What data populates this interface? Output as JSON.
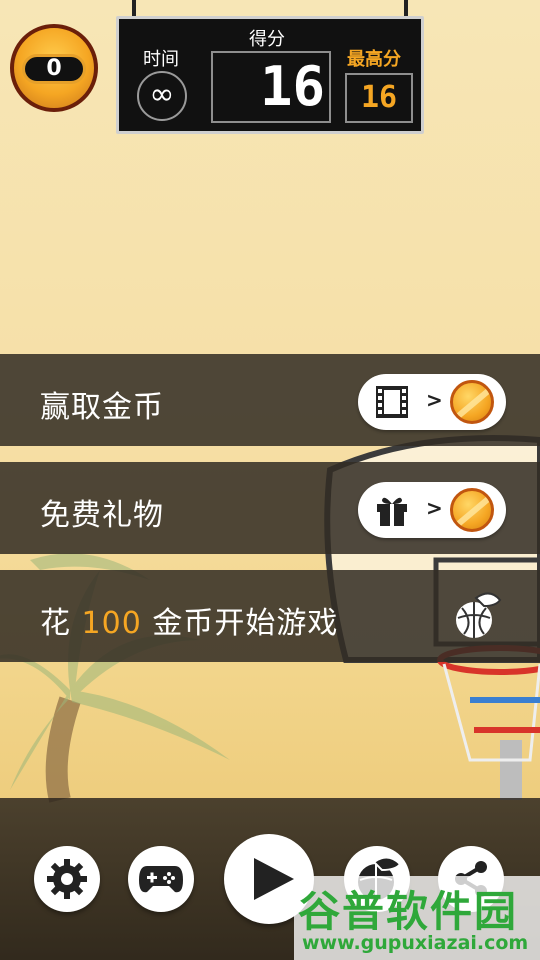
{
  "coins": "0",
  "scoreboard": {
    "time_label": "时间",
    "time_value": "∞",
    "score_label": "得分",
    "score": "16",
    "best_label": "最高分",
    "best": "16"
  },
  "menu": {
    "earn_coins": {
      "label": "赢取金币",
      "arrow": ">",
      "icon": "film-icon"
    },
    "free_gift": {
      "label": "免费礼物",
      "arrow": ">",
      "icon": "gift-icon"
    },
    "spend": {
      "prefix": "花 ",
      "amount": "100",
      "suffix": " 金币开始游戏",
      "icon": "basketball-hat-icon"
    }
  },
  "bottom_bar": {
    "buttons": [
      "gear-icon",
      "gamepad-icon",
      "play-icon",
      "basketball-hat-icon",
      "share-icon"
    ]
  },
  "watermark": {
    "title": "谷普软件园",
    "url": "www.gupuxiazai.com"
  },
  "colors": {
    "accent": "#f5a623",
    "panel": "#322c24",
    "brand_green": "#2fa83a"
  }
}
